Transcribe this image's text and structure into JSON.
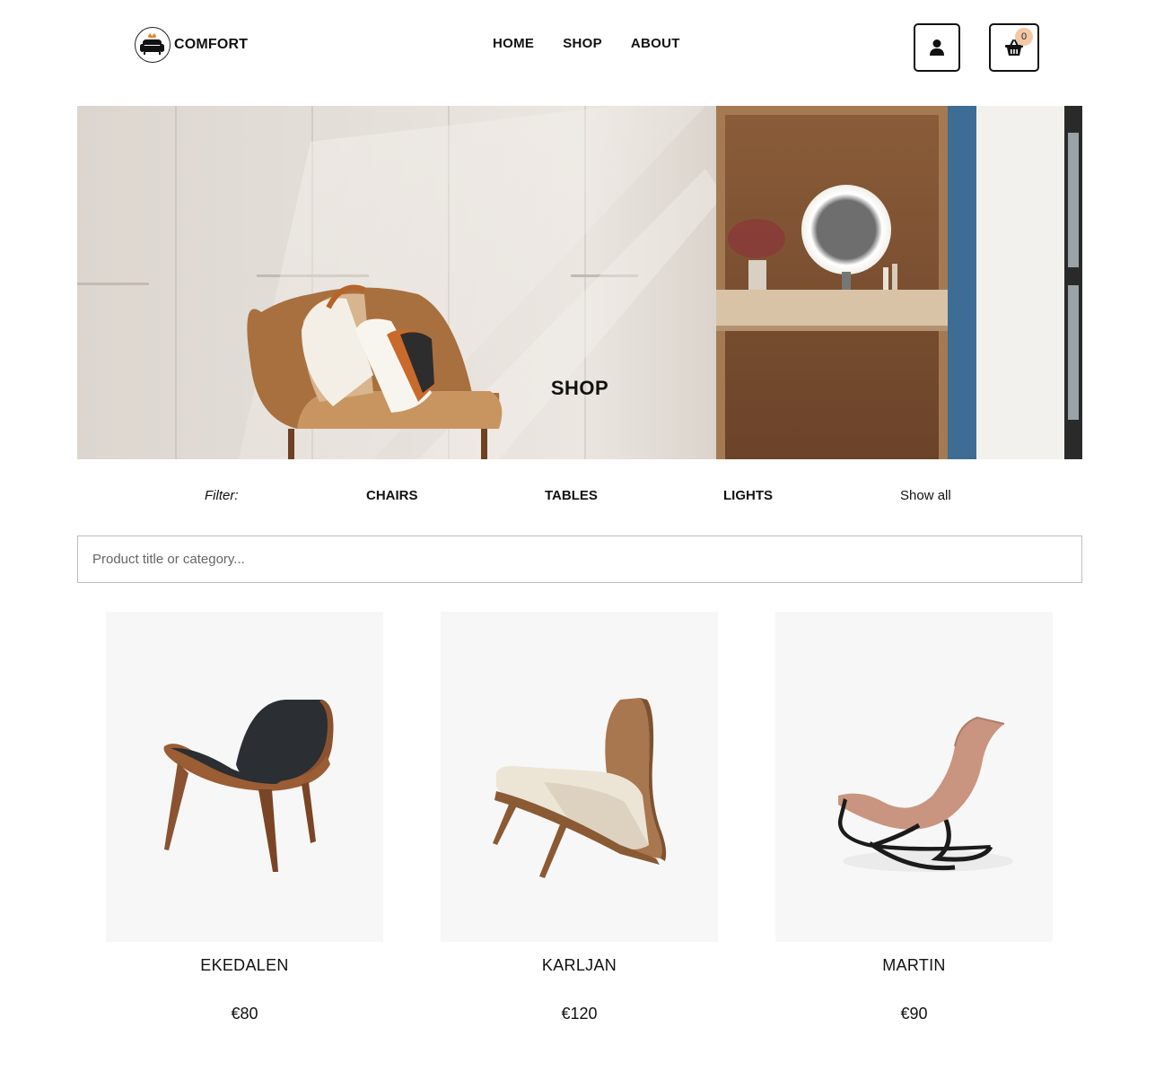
{
  "header": {
    "brand": "COMFORT",
    "nav": [
      "HOME",
      "SHOP",
      "ABOUT"
    ],
    "cart_count": "0",
    "icons": {
      "user": "user-icon",
      "cart": "basket-icon",
      "logo": "armchair-crown-icon"
    }
  },
  "hero": {
    "title": "SHOP"
  },
  "filter": {
    "label": "Filter:",
    "options": [
      "CHAIRS",
      "TABLES",
      "LIGHTS",
      "Show all"
    ]
  },
  "search": {
    "placeholder": "Product title or category..."
  },
  "products": [
    {
      "name": "EKEDALEN",
      "price": "€80"
    },
    {
      "name": "KARLJAN",
      "price": "€120"
    },
    {
      "name": "MARTIN",
      "price": "€90"
    }
  ],
  "colors": {
    "accent": "#f2c9a6",
    "text": "#111111",
    "card_bg": "#f7f7f7"
  }
}
